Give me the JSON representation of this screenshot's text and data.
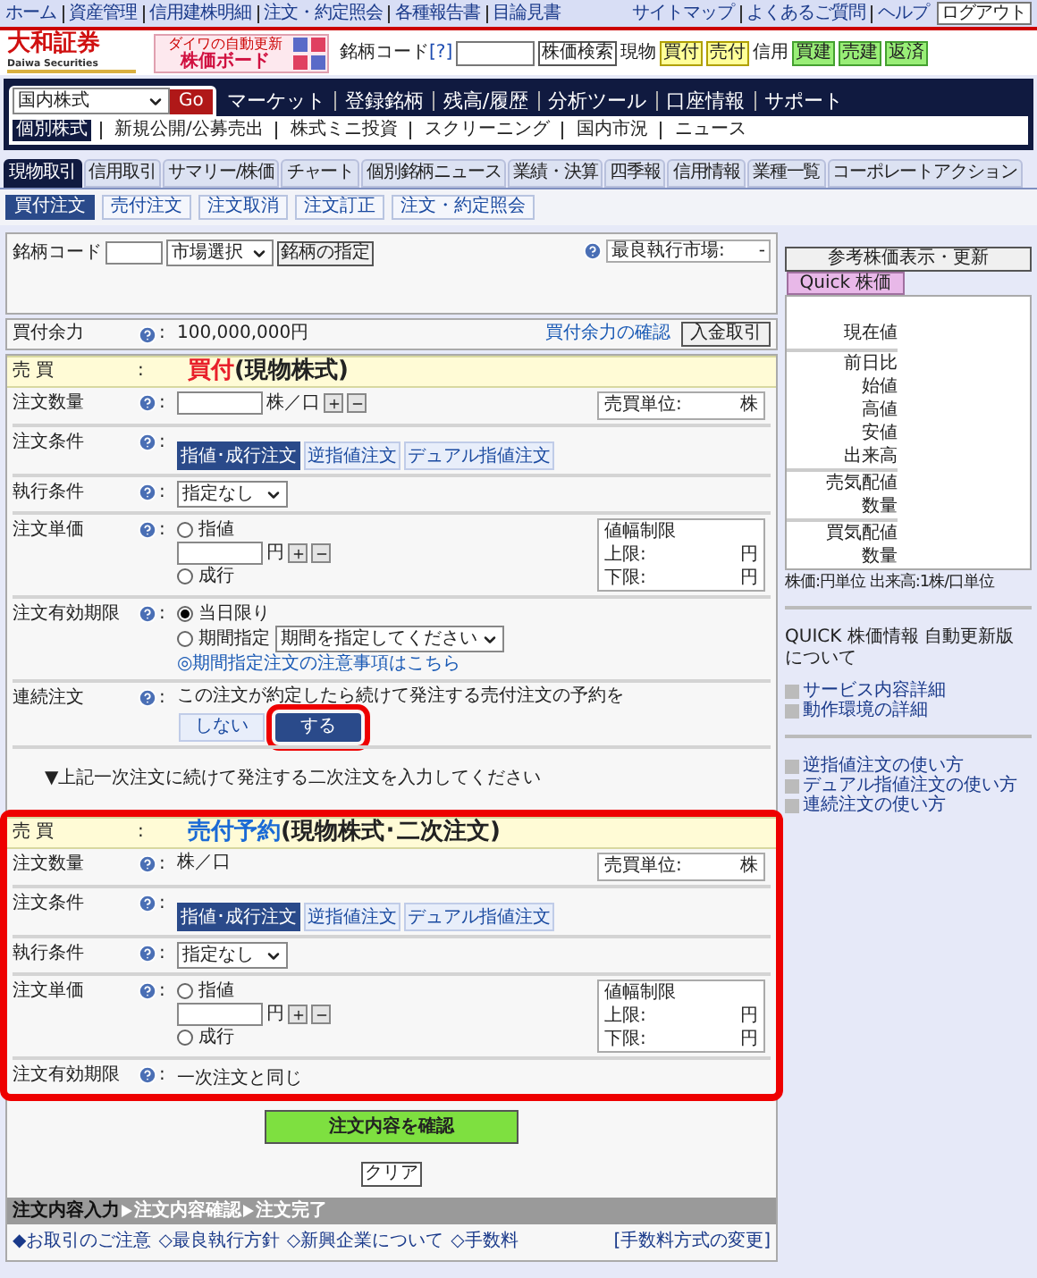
{
  "top_links": [
    "ホーム",
    "資産管理",
    "信用建株明細",
    "注文・約定照会",
    "各種報告書",
    "目論見書"
  ],
  "top_links_right": [
    "サイトマップ",
    "よくあるご質問",
    "ヘルプ"
  ],
  "logout_button": "ログアウト",
  "logo": {
    "name": "大和証券",
    "sub": "Daiwa Securities"
  },
  "banner": {
    "small": "ダイワの自動更新",
    "main": "株価ボード"
  },
  "search": {
    "label": "銘柄コード",
    "help": "[?]",
    "button": "株価検索"
  },
  "quick_buttons": [
    {
      "label": "現物",
      "kind": "label"
    },
    {
      "label": "買付",
      "kind": "cash"
    },
    {
      "label": "売付",
      "kind": "cash"
    },
    {
      "label": "信用",
      "kind": "label"
    },
    {
      "label": "買建",
      "kind": "margin"
    },
    {
      "label": "売建",
      "kind": "margin"
    },
    {
      "label": "返済",
      "kind": "margin"
    }
  ],
  "nav": {
    "select": "国内株式",
    "go": "Go",
    "items": [
      "マーケット",
      "登録銘柄",
      "残高/履歴",
      "分析ツール",
      "口座情報",
      "サポート"
    ]
  },
  "subnav": [
    {
      "label": "個別株式",
      "selected": true
    },
    {
      "label": "新規公開/公募売出",
      "selected": false
    },
    {
      "label": "株式ミニ投資",
      "selected": false
    },
    {
      "label": "スクリーニング",
      "selected": false
    },
    {
      "label": "国内市況",
      "selected": false
    },
    {
      "label": "ニュース",
      "selected": false
    }
  ],
  "tabs": [
    {
      "label": "現物取引",
      "selected": true
    },
    {
      "label": "信用取引",
      "selected": false
    },
    {
      "label": "サマリー/株価",
      "selected": false
    },
    {
      "label": "チャート",
      "selected": false
    },
    {
      "label": "個別銘柄ニュース",
      "selected": false
    },
    {
      "label": "業績・決算",
      "selected": false
    },
    {
      "label": "四季報",
      "selected": false
    },
    {
      "label": "信用情報",
      "selected": false
    },
    {
      "label": "業種一覧",
      "selected": false
    },
    {
      "label": "コーポレートアクション",
      "selected": false
    }
  ],
  "subtabs": [
    {
      "label": "買付注文",
      "selected": true
    },
    {
      "label": "売付注文",
      "selected": false
    },
    {
      "label": "注文取消",
      "selected": false
    },
    {
      "label": "注文訂正",
      "selected": false
    },
    {
      "label": "注文・約定照会",
      "selected": false
    }
  ],
  "stock_form": {
    "label": "銘柄コード",
    "market_select": "市場選択",
    "button": "銘柄の指定",
    "best_market_label": "最良執行市場:",
    "best_market_value": "-"
  },
  "buying_power": {
    "label": "買付余力",
    "sep": ":",
    "value": "100,000,000円",
    "link": "買付余力の確認",
    "button": "入金取引"
  },
  "primary_order": {
    "highlight": false,
    "trade": {
      "label": "売 買",
      "sep": ":",
      "type": "買付",
      "kind": "buy",
      "detail": "(現物株式)"
    },
    "rows": [
      {
        "kind": "quantity",
        "label": "注文数量",
        "sep": ":",
        "editable": true,
        "unit": "株／口",
        "unit_box": {
          "label": "売買単位:",
          "value": "株"
        }
      },
      {
        "kind": "condition",
        "label": "注文条件",
        "sep": ":",
        "options": [
          {
            "label": "指値･成行注文",
            "selected": true
          },
          {
            "label": "逆指値注文",
            "selected": false
          },
          {
            "label": "デュアル指値注文",
            "selected": false
          }
        ]
      },
      {
        "kind": "execution",
        "label": "執行条件",
        "sep": ":",
        "value": "指定なし"
      },
      {
        "kind": "price",
        "label": "注文単価",
        "sep": ":",
        "options": [
          {
            "label": "指値",
            "selected": false
          },
          {
            "label": "成行",
            "selected": false
          }
        ],
        "unit": "円",
        "limits": {
          "title": "値幅制限",
          "rows": [
            {
              "label": "上限:",
              "unit": "円"
            },
            {
              "label": "下限:",
              "unit": "円"
            }
          ]
        }
      },
      {
        "kind": "expiry",
        "label": "注文有効期限",
        "sep": ":",
        "options": [
          {
            "label": "当日限り",
            "selected": true
          },
          {
            "label": "期間指定",
            "selected": false
          }
        ],
        "period_select": "期間を指定してください",
        "link": "◎期間指定注文の注意事項はこちら"
      },
      {
        "kind": "chain",
        "label": "連続注文",
        "sep": ":",
        "text": "この注文が約定したら続けて発注する売付注文の予約を",
        "buttons": [
          {
            "label": "しない",
            "selected": false,
            "highlight": false
          },
          {
            "label": "する",
            "selected": true,
            "highlight": true
          }
        ]
      }
    ]
  },
  "secondary_note": "▼上記一次注文に続けて発注する二次注文を入力してください",
  "secondary_order": {
    "highlight": true,
    "trade": {
      "label": "売 買",
      "sep": ":",
      "type": "売付予約",
      "kind": "sell",
      "detail": "(現物株式･二次注文)"
    },
    "rows": [
      {
        "kind": "quantity",
        "label": "注文数量",
        "sep": ":",
        "editable": false,
        "unit": "株／口",
        "unit_box": {
          "label": "売買単位:",
          "value": "株"
        }
      },
      {
        "kind": "condition",
        "label": "注文条件",
        "sep": ":",
        "options": [
          {
            "label": "指値･成行注文",
            "selected": true
          },
          {
            "label": "逆指値注文",
            "selected": false
          },
          {
            "label": "デュアル指値注文",
            "selected": false
          }
        ]
      },
      {
        "kind": "execution",
        "label": "執行条件",
        "sep": ":",
        "value": "指定なし"
      },
      {
        "kind": "price",
        "label": "注文単価",
        "sep": ":",
        "options": [
          {
            "label": "指値",
            "selected": false
          },
          {
            "label": "成行",
            "selected": false
          }
        ],
        "unit": "円",
        "limits": {
          "title": "値幅制限",
          "rows": [
            {
              "label": "上限:",
              "unit": "円"
            },
            {
              "label": "下限:",
              "unit": "円"
            }
          ]
        }
      },
      {
        "kind": "text",
        "label": "注文有効期限",
        "sep": ":",
        "value": "一次注文と同じ"
      }
    ]
  },
  "confirm_button": "注文内容を確認",
  "clear_button": "クリア",
  "steps": [
    {
      "label": "注文内容入力",
      "selected": true
    },
    {
      "label": "注文内容確認",
      "selected": false
    },
    {
      "label": "注文完了",
      "selected": false
    }
  ],
  "footer_links": [
    "◆お取引のご注意",
    "◇最良執行方針",
    "◇新興企業について",
    "◇手数料"
  ],
  "footer_right": "[手数料方式の変更]",
  "sidebar": {
    "refresh_button": "参考株価表示・更新",
    "quick_tab": "Quick 株価",
    "quote_groups": [
      [
        "現在値"
      ],
      [
        "前日比",
        "始値",
        "高値",
        "安値",
        "出来高"
      ],
      [
        "売気配値",
        "数量"
      ],
      [
        "買気配値",
        "数量"
      ]
    ],
    "unit_note": "株価:円単位 出来高:1株/口単位",
    "info": "QUICK 株価情報 自動更新版について",
    "links": [
      "サービス内容詳細",
      "動作環境の詳細"
    ],
    "guide_links": [
      "逆指値注文の使い方",
      "デュアル指値注文の使い方",
      "連続注文の使い方"
    ]
  }
}
